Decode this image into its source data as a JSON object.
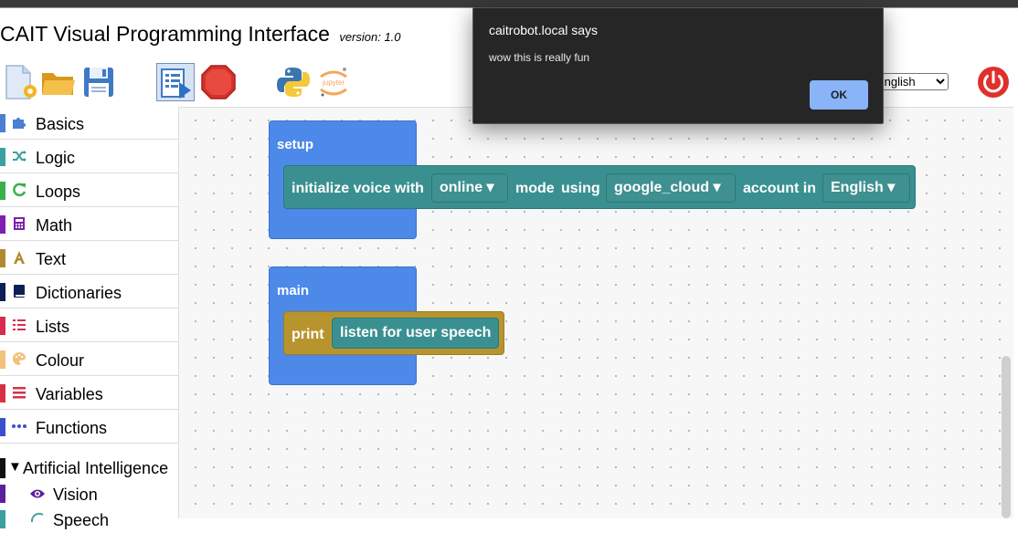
{
  "app": {
    "title": "CAIT Visual Programming Interface",
    "version": "version: 1.0"
  },
  "toolbar": {
    "icons": [
      "new-file-icon",
      "open-folder-icon",
      "save-icon",
      "run-icon",
      "stop-icon",
      "python-icon",
      "jupyter-icon"
    ],
    "jupyter_label": "jupyter",
    "language_value": "English",
    "language_options": [
      "English"
    ]
  },
  "sidebar": {
    "categories": [
      {
        "label": "Basics",
        "color": "#4a7fd4",
        "icon": "puzzle-icon"
      },
      {
        "label": "Logic",
        "color": "#3aa0a0",
        "icon": "shuffle-icon"
      },
      {
        "label": "Loops",
        "color": "#3ab04a",
        "icon": "loop-icon"
      },
      {
        "label": "Math",
        "color": "#7d1fb0",
        "icon": "calculator-icon"
      },
      {
        "label": "Text",
        "color": "#b08a30",
        "icon": "text-icon"
      },
      {
        "label": "Dictionaries",
        "color": "#0e1f55",
        "icon": "book-icon"
      },
      {
        "label": "Lists",
        "color": "#d62d4c",
        "icon": "list-icon"
      },
      {
        "label": "Colour",
        "color": "#f0c27a",
        "icon": "palette-icon"
      },
      {
        "label": "Variables",
        "color": "#d63246",
        "icon": "variables-icon"
      },
      {
        "label": "Functions",
        "color": "#3c4fcf",
        "icon": "dots-icon"
      }
    ],
    "ai_section": {
      "label": "Artificial Intelligence",
      "toggle": "▼"
    },
    "ai_items": [
      {
        "label": "Vision",
        "color": "#5a1f9a",
        "icon": "eye-icon"
      },
      {
        "label": "Speech",
        "color": "#3aa0a0",
        "icon": "speech-icon"
      }
    ]
  },
  "blocks": {
    "setup": {
      "title": "setup",
      "statement": {
        "prefix": "initialize voice with",
        "mode_value": "online ▾",
        "mid1": "mode",
        "mid2": "using",
        "account_value": "google_cloud ▾",
        "mid3": "account in",
        "language_value": "English ▾"
      }
    },
    "main": {
      "title": "main",
      "statement": {
        "keyword": "print",
        "argument": "listen for user speech"
      }
    }
  },
  "dialog": {
    "origin": "caitrobot.local says",
    "message": "wow this is really fun",
    "ok_label": "OK"
  },
  "colors": {
    "hat": "#4c89e8",
    "voice_block": "#3a9090",
    "print_block": "#b8942e",
    "dialog_bg": "#262626",
    "ok_button": "#8ab4f8"
  }
}
